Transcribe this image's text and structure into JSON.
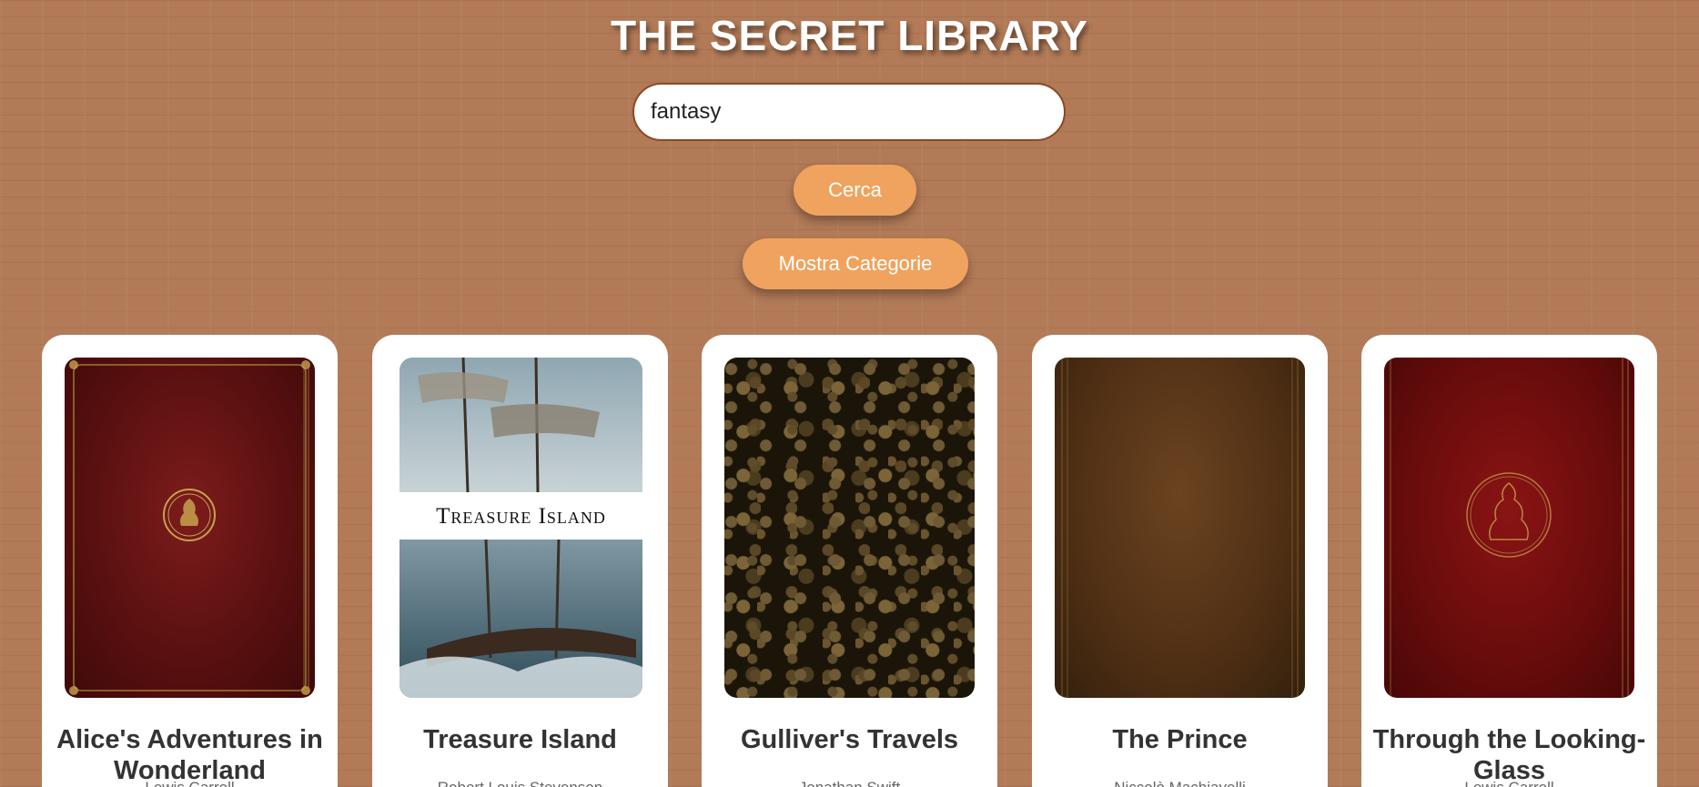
{
  "header": {
    "title": "THE SECRET LIBRARY"
  },
  "search": {
    "value": "fantasy",
    "button_label": "Cerca"
  },
  "categories_button_label": "Mostra Categorie",
  "books": [
    {
      "title": "Alice's Adventures in Wonderland",
      "author": "Lewis Carroll"
    },
    {
      "title": "Treasure Island",
      "author": "Robert Louis Stevenson",
      "cover_text": "Treasure Island"
    },
    {
      "title": "Gulliver's Travels",
      "author": "Jonathan Swift"
    },
    {
      "title": "The Prince",
      "author": "Niccolò Machiavelli"
    },
    {
      "title": "Through the Looking-Glass",
      "author": "Lewis Carroll"
    }
  ],
  "colors": {
    "background": "#b27a57",
    "button": "#f0a35e",
    "card": "#ffffff",
    "title_text": "#ffffff",
    "book_title_text": "#333333"
  }
}
